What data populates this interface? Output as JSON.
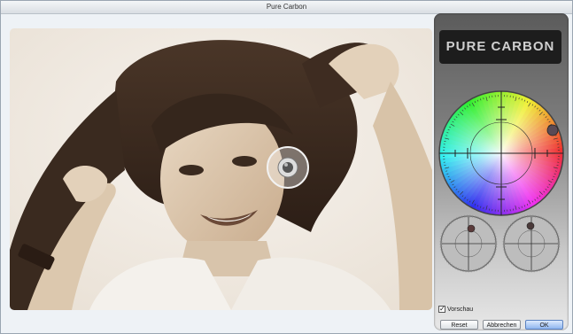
{
  "window": {
    "title": "Pure Carbon"
  },
  "panel": {
    "brand": "PURE CARBON"
  },
  "preview": {
    "label": "Vorschau",
    "checked": true,
    "check_glyph": "✓"
  },
  "buttons": {
    "reset": "Reset",
    "cancel": "Abbrechen",
    "ok": "OK"
  },
  "icons": {
    "picker": "color-picker-handle-icon",
    "wheel": "color-wheel-icon"
  },
  "colors": {
    "sepia_light": "#f3eee7",
    "sepia_dark": "#3b2a20",
    "panel_dark": "#1d1d1d",
    "ok_blue": "#8fb6ef"
  }
}
